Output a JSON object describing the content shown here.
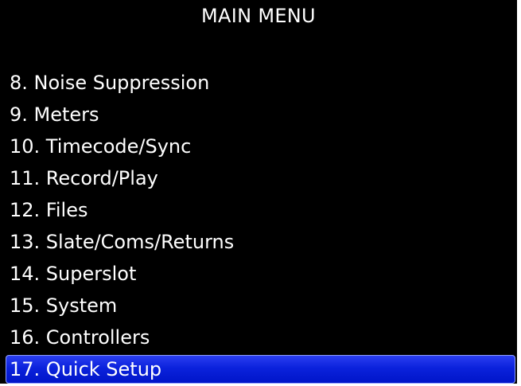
{
  "screen": {
    "title": "MAIN MENU"
  },
  "menu": {
    "items": [
      {
        "label": "8. Noise Suppression",
        "selected": false
      },
      {
        "label": "9. Meters",
        "selected": false
      },
      {
        "label": "10. Timecode/Sync",
        "selected": false
      },
      {
        "label": "11. Record/Play",
        "selected": false
      },
      {
        "label": "12. Files",
        "selected": false
      },
      {
        "label": "13. Slate/Coms/Returns",
        "selected": false
      },
      {
        "label": "14. Superslot",
        "selected": false
      },
      {
        "label": "15. System",
        "selected": false
      },
      {
        "label": "16. Controllers",
        "selected": false
      },
      {
        "label": "17. Quick Setup",
        "selected": true
      }
    ]
  },
  "colors": {
    "background": "#000000",
    "text": "#ffffff",
    "selection": "#0b22dc"
  }
}
